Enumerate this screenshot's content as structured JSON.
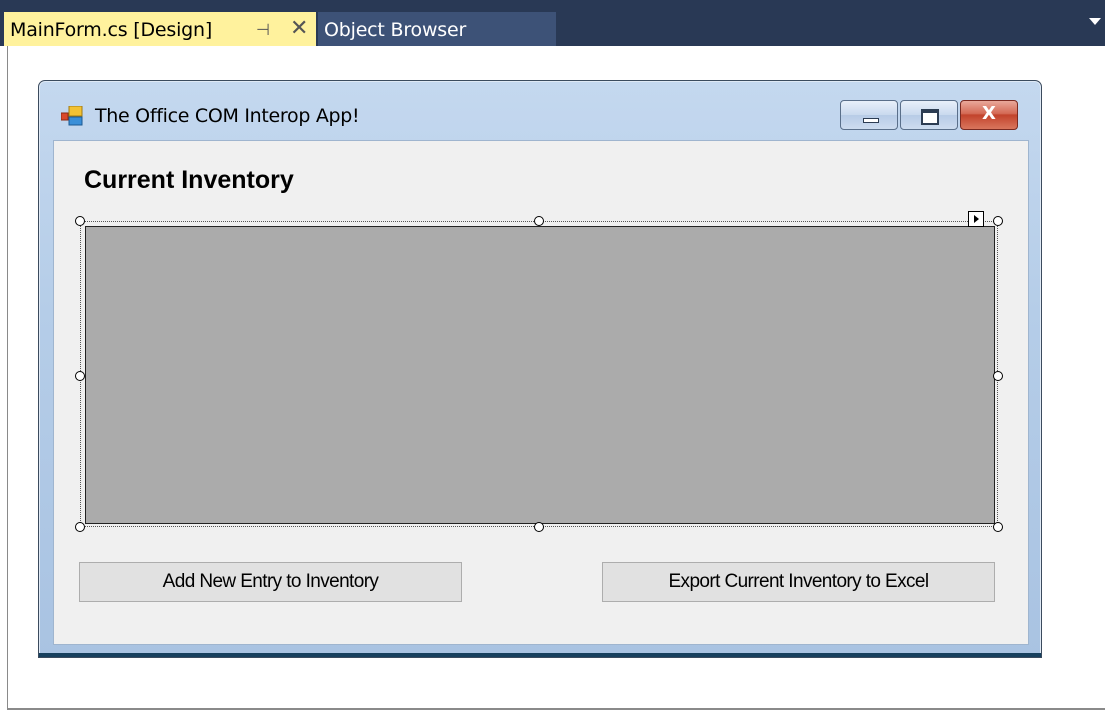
{
  "ide": {
    "tabs": [
      {
        "label": "MainForm.cs [Design]",
        "active": true,
        "pin_icon": "pin-icon",
        "close_glyph": "✕"
      },
      {
        "label": "Object Browser",
        "active": false
      }
    ],
    "colors": {
      "tab_strip": "#293955",
      "active_tab": "#fff29d",
      "inactive_tab": "#3d5277"
    }
  },
  "form": {
    "title": "The Office COM Interop App!",
    "icon": "windows-form-icon",
    "caption_buttons": {
      "minimize": "minimize-icon",
      "maximize": "maximize-icon",
      "close": "X"
    },
    "heading": "Current Inventory",
    "grid": {
      "name": "data-grid",
      "selected": true,
      "background": "#ababab"
    },
    "buttons": {
      "add": "Add New Entry to Inventory",
      "export": "Export Current Inventory to Excel"
    }
  }
}
